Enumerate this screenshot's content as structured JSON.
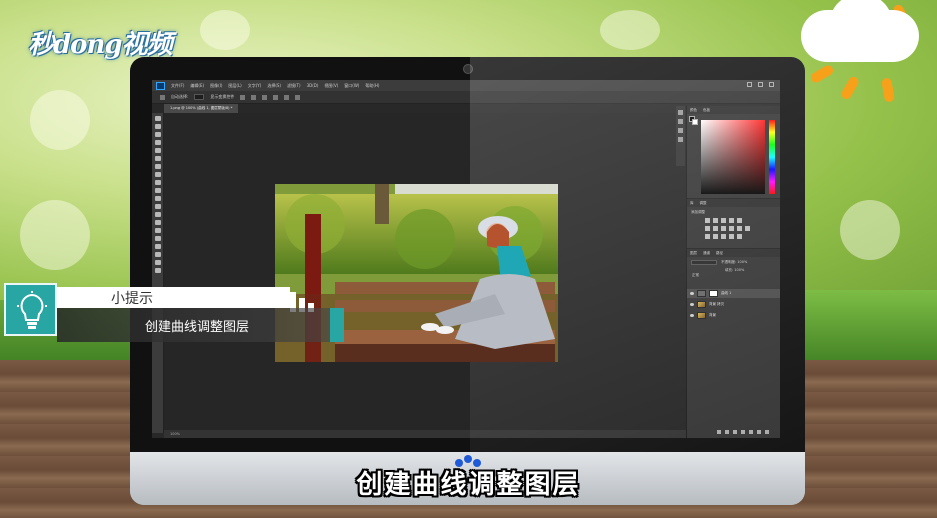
{
  "brand": {
    "logo_text": "秒dong视频"
  },
  "photoshop": {
    "menu": [
      "文件(F)",
      "编辑(E)",
      "图像(I)",
      "图层(L)",
      "文字(Y)",
      "选择(S)",
      "滤镜(T)",
      "3D(D)",
      "视图(V)",
      "窗口(W)",
      "帮助(H)"
    ],
    "options": {
      "auto_select": "自动选择:",
      "group": "图层",
      "show_transform": "显示变换控件"
    },
    "tabs": [
      "1.png @ 100% (曲线 1, 图层蒙版/8) *"
    ],
    "status": "100%",
    "panels": {
      "color_tabs": [
        "颜色",
        "色板"
      ],
      "adjust_tabs": [
        "库",
        "调整"
      ],
      "adjust_label": "添加调整",
      "layers_tabs": [
        "图层",
        "通道",
        "路径"
      ],
      "blend_mode": "正常",
      "opacity": "不透明度: 100%",
      "fill": "填充: 100%",
      "layers": [
        "曲线 1",
        "背景 拷贝",
        "背景"
      ]
    }
  },
  "tip": {
    "title": "小提示",
    "text": "创建曲线调整图层"
  },
  "subtitle": "创建曲线调整图层",
  "colors": {
    "accent": "#27a6a3",
    "brand_blue": "#2a6fa0"
  }
}
